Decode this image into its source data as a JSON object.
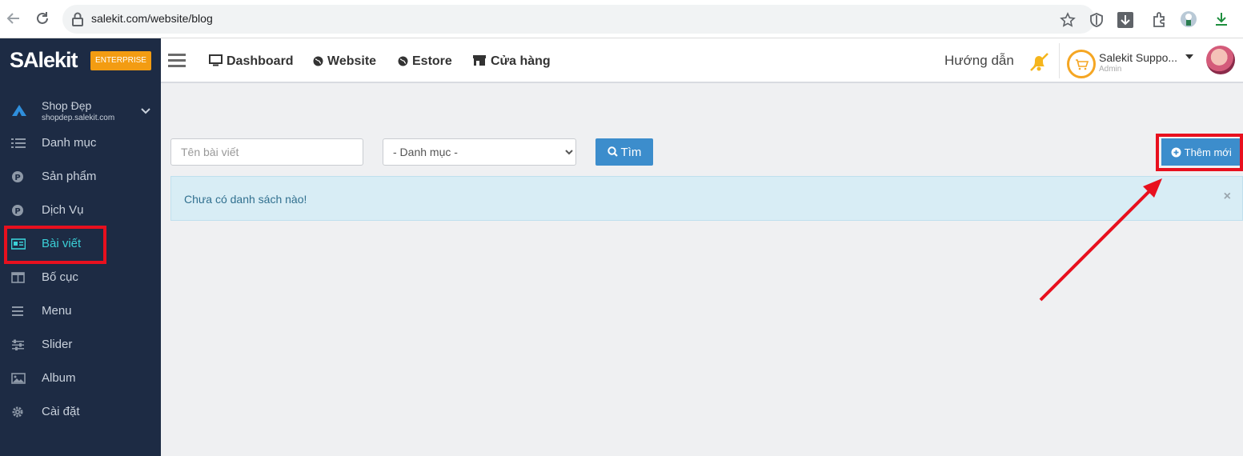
{
  "browser": {
    "url": "salekit.com/website/blog"
  },
  "brand": {
    "logo": "SAlekit",
    "badge": "ENTERPRISE"
  },
  "shop": {
    "name": "Shop Đẹp",
    "domain": "shopdep.salekit.com"
  },
  "sidebar": {
    "items": [
      {
        "label": "Danh mục",
        "icon": "list-icon"
      },
      {
        "label": "Sản phẩm",
        "icon": "product-p-icon"
      },
      {
        "label": "Dịch Vụ",
        "icon": "service-p-icon"
      },
      {
        "label": "Bài viết",
        "icon": "newspaper-icon",
        "active": true
      },
      {
        "label": "Bố cục",
        "icon": "layout-columns-icon"
      },
      {
        "label": "Menu",
        "icon": "menu-bars-icon"
      },
      {
        "label": "Slider",
        "icon": "sliders-icon"
      },
      {
        "label": "Album",
        "icon": "image-icon"
      },
      {
        "label": "Cài đặt",
        "icon": "gear-icon"
      }
    ]
  },
  "topnav": {
    "items": [
      {
        "label": "Dashboard",
        "icon": "monitor-icon"
      },
      {
        "label": "Website",
        "icon": "globe-icon"
      },
      {
        "label": "Estore",
        "icon": "globe-icon"
      },
      {
        "label": "Cửa hàng",
        "icon": "store-icon"
      }
    ],
    "guide": "Hướng dẫn",
    "user_name": "Salekit Suppo...",
    "user_role": "Admin"
  },
  "filters": {
    "title_placeholder": "Tên bài viết",
    "category_selected": "- Danh mục -",
    "search_label": "Tìm",
    "add_label": "Thêm mới"
  },
  "alert": {
    "message": "Chưa có danh sách nào!",
    "close": "×"
  },
  "colors": {
    "sidebar_bg": "#1d2b44",
    "active": "#3bd0d8",
    "primary": "#3c8dcc",
    "highlight": "#e8101e",
    "badge": "#f39c12"
  }
}
